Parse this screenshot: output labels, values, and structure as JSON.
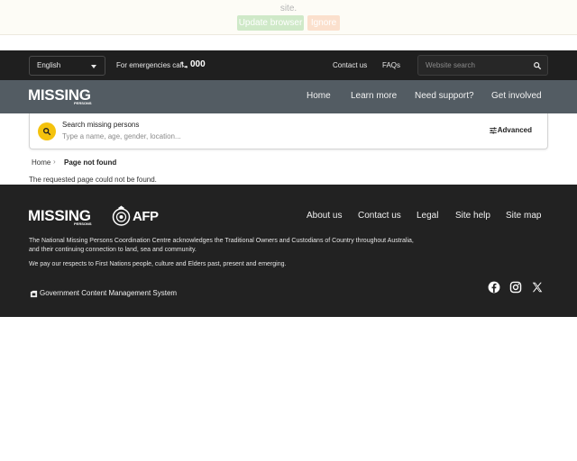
{
  "banner": {
    "text": "site.",
    "update_label": "Update browser",
    "ignore_label": "Ignore"
  },
  "utility": {
    "language": "English",
    "emergency_label": "For emergencies call",
    "emergency_number": "000",
    "contact_label": "Contact us",
    "faqs_label": "FAQs",
    "search_placeholder": "Website search"
  },
  "nav": {
    "logo_text": "MISSING",
    "logo_sub": "PERSONS",
    "items": [
      {
        "label": "Home"
      },
      {
        "label": "Learn more"
      },
      {
        "label": "Need support?"
      },
      {
        "label": "Get involved"
      }
    ]
  },
  "search_panel": {
    "label": "Search missing persons",
    "placeholder": "Type a name, age, gender, location...",
    "advanced_label": "Advanced"
  },
  "breadcrumb": {
    "home": "Home",
    "separator": "›",
    "current": "Page not found"
  },
  "main": {
    "message": "The requested page could not be found."
  },
  "footer": {
    "logo_text": "MISSING",
    "logo_sub": "PERSONS",
    "afp_text": "AFP",
    "links": [
      {
        "label": "About us"
      },
      {
        "label": "Contact us"
      },
      {
        "label": "Legal"
      },
      {
        "label": "Site help"
      },
      {
        "label": "Site map"
      }
    ],
    "acknowledgement": "The National Missing Persons Coordination Centre acknowledges the Traditional Owners and Custodians of Country throughout Australia, and their continuing connection to land, sea and community.",
    "respects": "We pay our respects to First Nations people, culture and Elders past, present and emerging.",
    "gcms_label": "Government Content Management System"
  },
  "colors": {
    "utility_bg": "#1f1f1f",
    "nav_bg": "#535c63",
    "footer_bg": "#222222",
    "accent_yellow": "#f4c20d"
  },
  "icons": {
    "phone": "phone-icon",
    "search": "search-icon",
    "filter": "sliders-icon",
    "facebook": "facebook-icon",
    "instagram": "instagram-icon",
    "x": "x-icon"
  }
}
